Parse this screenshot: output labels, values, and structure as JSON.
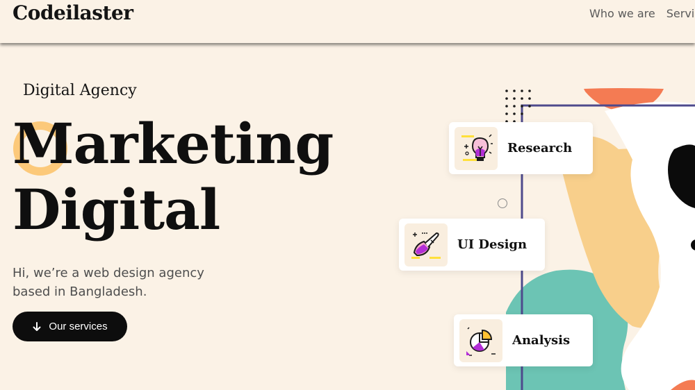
{
  "header": {
    "logo": "Codeilaster",
    "nav": [
      "Who we are",
      "Servi"
    ]
  },
  "hero": {
    "eyebrow": "Digital Agency",
    "title_line1": "Marketing",
    "title_line2": "Digital",
    "description": "Hi, we’re a web design agency based in Bangladesh.",
    "cta_label": "Our services"
  },
  "cards": [
    {
      "label": "Research",
      "icon": "lightbulb-icon"
    },
    {
      "label": "UI Design",
      "icon": "paintbrush-icon"
    },
    {
      "label": "Analysis",
      "icon": "pie-chart-icon"
    }
  ],
  "colors": {
    "background": "#fbf2e6",
    "accent_yellow": "#fcc97a",
    "accent_orange": "#f47b53",
    "accent_teal": "#6cc4b4",
    "frame_purple": "#4e4a8c",
    "dark": "#0d0d0d"
  }
}
